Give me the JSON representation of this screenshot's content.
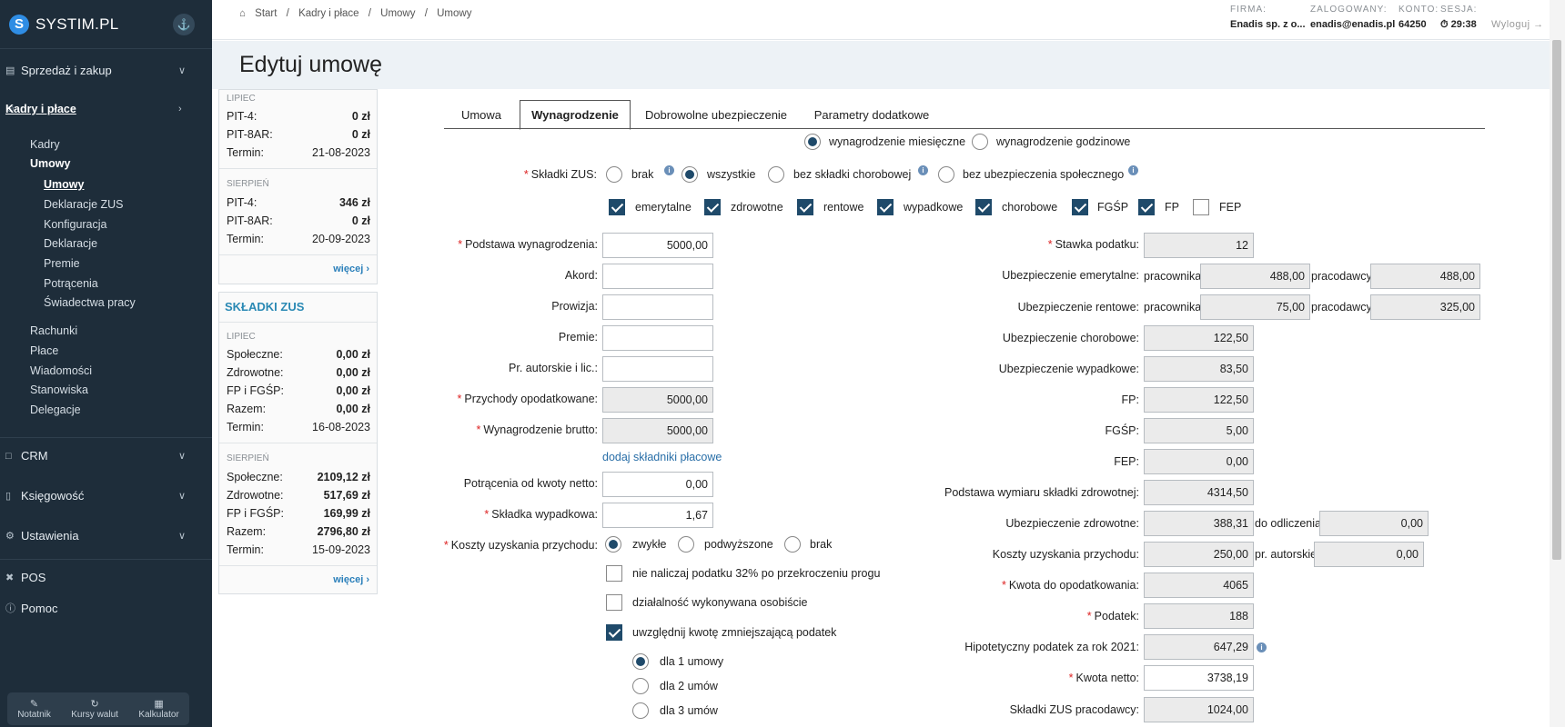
{
  "app": {
    "logo_letter": "S",
    "logo_text": "SYSTIM.PL"
  },
  "sidebar": {
    "sections": [
      {
        "label": "Sprzedaż i zakup"
      },
      {
        "label": "Kadry i płace"
      },
      {
        "label": "CRM"
      },
      {
        "label": "Księgowość"
      },
      {
        "label": "Ustawienia"
      },
      {
        "label": "POS"
      },
      {
        "label": "Pomoc"
      }
    ],
    "kadry_items": [
      "Kadry",
      "Umowy",
      "Umowy",
      "Deklaracje ZUS",
      "Konfiguracja",
      "Deklaracje",
      "Premie",
      "Potrącenia",
      "Świadectwa pracy",
      "Rachunki",
      "Płace",
      "Wiadomości",
      "Stanowiska",
      "Delegacje"
    ],
    "tools": [
      {
        "label": "Notatnik"
      },
      {
        "label": "Kursy walut"
      },
      {
        "label": "Kalkulator"
      }
    ]
  },
  "breadcrumb": [
    "Start",
    "/",
    "Kadry i płace",
    "/",
    "Umowy",
    "/",
    "Umowy"
  ],
  "header": {
    "firma_label": "FIRMA:",
    "firma_value": "Enadis sp. z o...",
    "zalogowany_label": "ZALOGOWANY:",
    "zalogowany_value": "enadis@enadis.pl",
    "konto_label": "KONTO:",
    "konto_value": "64250",
    "sesja_label": "SESJA:",
    "sesja_value": "29:38",
    "logout": "Wyloguj"
  },
  "page_title": "Edytuj umowę",
  "pit_panel": {
    "m1": "LIPIEC",
    "m1_pit4_label": "PIT-4:",
    "m1_pit4": "0 zł",
    "m1_pit8_label": "PIT-8AR:",
    "m1_pit8": "0 zł",
    "m1_term_label": "Termin:",
    "m1_term": "21-08-2023",
    "m2": "SIERPIEŃ",
    "m2_pit4_label": "PIT-4:",
    "m2_pit4": "346 zł",
    "m2_pit8_label": "PIT-8AR:",
    "m2_pit8": "0 zł",
    "m2_term_label": "Termin:",
    "m2_term": "20-09-2023",
    "more": "więcej"
  },
  "zus_panel": {
    "title": "SKŁADKI ZUS",
    "m1": "LIPIEC",
    "m1_rows": [
      [
        "Społeczne:",
        "0,00 zł"
      ],
      [
        "Zdrowotne:",
        "0,00 zł"
      ],
      [
        "FP i FGŚP:",
        "0,00 zł"
      ],
      [
        "Razem:",
        "0,00 zł"
      ],
      [
        "Termin:",
        "16-08-2023"
      ]
    ],
    "m2": "SIERPIEŃ",
    "m2_rows": [
      [
        "Społeczne:",
        "2109,12 zł"
      ],
      [
        "Zdrowotne:",
        "517,69 zł"
      ],
      [
        "FP i FGŚP:",
        "169,99 zł"
      ],
      [
        "Razem:",
        "2796,80 zł"
      ],
      [
        "Termin:",
        "15-09-2023"
      ]
    ],
    "more": "więcej"
  },
  "tabs": [
    "Umowa",
    "Wynagrodzenie",
    "Dobrowolne ubezpieczenie",
    "Parametry dodatkowe"
  ],
  "wage_type": {
    "monthly": "wynagrodzenie miesięczne",
    "hourly": "wynagrodzenie godzinowe"
  },
  "zus": {
    "label": "Składki ZUS:",
    "options": [
      "brak",
      "wszystkie",
      "bez składki chorobowej",
      "bez ubezpieczenia społecznego"
    ],
    "checks": [
      "emerytalne",
      "zdrowotne",
      "rentowe",
      "wypadkowe",
      "chorobowe",
      "FGŚP",
      "FP",
      "FEP"
    ]
  },
  "left_form": {
    "podstawa_label": "Podstawa wynagrodzenia:",
    "podstawa": "5000,00",
    "akord_label": "Akord:",
    "akord": "",
    "prowizja_label": "Prowizja:",
    "prowizja": "",
    "premie_label": "Premie:",
    "premie": "",
    "autorskie_label": "Pr. autorskie i lic.:",
    "autorskie": "",
    "przychody_label": "Przychody opodatkowane:",
    "przychody": "5000,00",
    "brutto_label": "Wynagrodzenie brutto:",
    "brutto": "5000,00",
    "dodaj_link": "dodaj składniki płacowe",
    "potracenia_label": "Potrącenia od kwoty netto:",
    "potracenia": "0,00",
    "wypadkowa_label": "Składka wypadkowa:",
    "wypadkowa": "1,67",
    "koszty_label": "Koszty uzyskania przychodu:",
    "koszty_options": [
      "zwykłe",
      "podwyższone",
      "brak"
    ],
    "opt1": "nie naliczaj podatku 32% po przekroczeniu progu",
    "opt2": "działalność wykonywana osobiście",
    "opt3": "uwzględnij kwotę zmniejszającą podatek",
    "umowy": [
      "dla 1 umowy",
      "dla 2 umów",
      "dla 3 umów"
    ]
  },
  "right_form": {
    "stawka_label": "Stawka podatku:",
    "stawka": "12",
    "emer_label": "Ubezpieczenie emerytalne:",
    "pracownika": "pracownika",
    "pracodawcy": "pracodawcy",
    "emer_prac": "488,00",
    "emer_pracod": "488,00",
    "rent_label": "Ubezpieczenie rentowe:",
    "rent_prac": "75,00",
    "rent_pracod": "325,00",
    "chor_label": "Ubezpieczenie chorobowe:",
    "chor": "122,50",
    "wyp_label": "Ubezpieczenie wypadkowe:",
    "wyp": "83,50",
    "fp_label": "FP:",
    "fp": "122,50",
    "fgsp_label": "FGŚP:",
    "fgsp": "5,00",
    "fep_label": "FEP:",
    "fep": "0,00",
    "pwsz_label": "Podstawa wymiaru składki zdrowotnej:",
    "pwsz": "4314,50",
    "zdr_label": "Ubezpieczenie zdrowotne:",
    "zdr": "388,31",
    "do_odl_label": "do odliczenia",
    "do_odl": "0,00",
    "kup_label": "Koszty uzyskania przychodu:",
    "kup": "250,00",
    "pr_aut_label": "pr. autorskie",
    "pr_aut": "0,00",
    "kdo_label": "Kwota do opodatkowania:",
    "kdo": "4065",
    "podatek_label": "Podatek:",
    "podatek": "188",
    "hipo_label": "Hipotetyczny podatek za rok 2021:",
    "hipo": "647,29",
    "netto_label": "Kwota netto:",
    "netto": "3738,19",
    "zus_pracod_label": "Składki ZUS pracodawcy:",
    "zus_pracod": "1024,00"
  }
}
